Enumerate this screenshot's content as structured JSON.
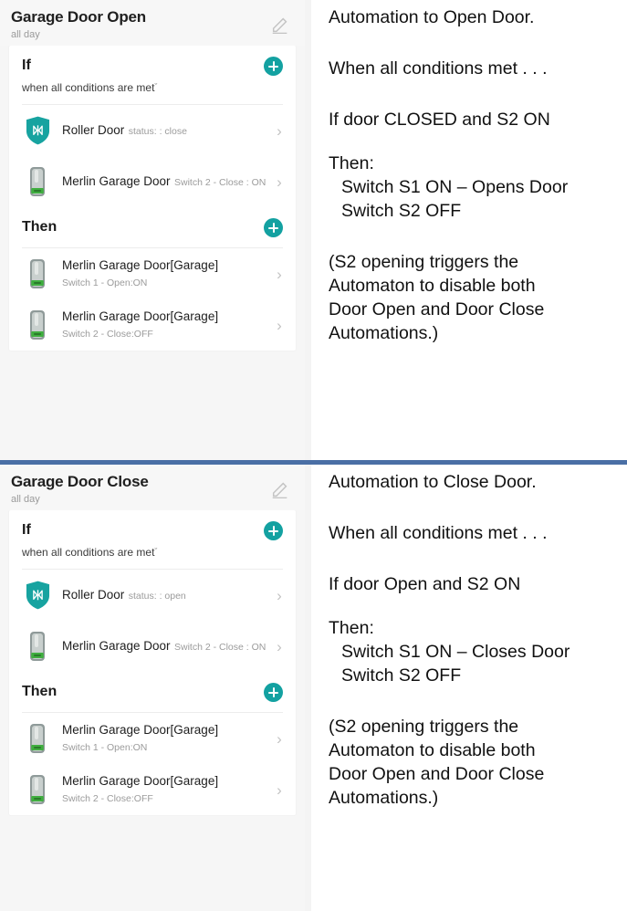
{
  "divider_color": "#4a6fa5",
  "accent_color": "#13a1a1",
  "panels": [
    {
      "header": {
        "title": "Garage Door Open",
        "subtitle": "all day",
        "edit_icon": "pencil-icon"
      },
      "if_section": {
        "title": "If",
        "subtitle": "when all conditions are met",
        "caret": "ˇ",
        "add_label": "+"
      },
      "if_items": [
        {
          "icon": "roller-door-shield-icon",
          "title": "Roller Door",
          "subtitle": "status: : close",
          "chevron": "›"
        },
        {
          "icon": "merlin-device-icon",
          "title": "Merlin Garage Door",
          "subtitle": "Switch 2 - Close : ON",
          "chevron": "›"
        }
      ],
      "then_section": {
        "title": "Then",
        "add_label": "+"
      },
      "then_items": [
        {
          "icon": "merlin-device-icon",
          "title": "Merlin Garage Door[Garage]",
          "subtitle": "Switch 1 - Open:ON",
          "chevron": "›"
        },
        {
          "icon": "merlin-device-icon",
          "title": "Merlin Garage Door[Garage]",
          "subtitle": "Switch 2 - Close:OFF",
          "chevron": "›"
        }
      ],
      "notes": {
        "heading": "Automation to Open Door.",
        "condition_intro": "When all conditions met . . .",
        "condition": "If door CLOSED and S2 ON",
        "then_label": "Then:",
        "then_line_1": "Switch S1 ON – Opens Door",
        "then_line_2": "Switch S2 OFF",
        "footnote": "(S2 opening triggers the\nAutomaton to disable both\nDoor Open and Door Close\nAutomations.)"
      }
    },
    {
      "header": {
        "title": "Garage Door Close",
        "subtitle": "all day",
        "edit_icon": "pencil-icon"
      },
      "if_section": {
        "title": "If",
        "subtitle": "when all conditions are met",
        "caret": "ˇ",
        "add_label": "+"
      },
      "if_items": [
        {
          "icon": "roller-door-shield-icon",
          "title": "Roller Door",
          "subtitle": "status: : open",
          "chevron": "›"
        },
        {
          "icon": "merlin-device-icon",
          "title": "Merlin Garage Door",
          "subtitle": "Switch 2 - Close : ON",
          "chevron": "›"
        }
      ],
      "then_section": {
        "title": "Then",
        "add_label": "+"
      },
      "then_items": [
        {
          "icon": "merlin-device-icon",
          "title": "Merlin Garage Door[Garage]",
          "subtitle": "Switch 1 - Open:ON",
          "chevron": "›"
        },
        {
          "icon": "merlin-device-icon",
          "title": "Merlin Garage Door[Garage]",
          "subtitle": "Switch 2 - Close:OFF",
          "chevron": "›"
        }
      ],
      "notes": {
        "heading": "Automation to Close Door.",
        "condition_intro": "When all conditions met . . .",
        "condition": "If door Open and S2 ON",
        "then_label": "Then:",
        "then_line_1": "Switch S1 ON – Closes Door",
        "then_line_2": "Switch S2 OFF",
        "footnote": "(S2 opening triggers the\nAutomaton to disable both\nDoor Open and Door Close\nAutomations.)"
      }
    }
  ]
}
